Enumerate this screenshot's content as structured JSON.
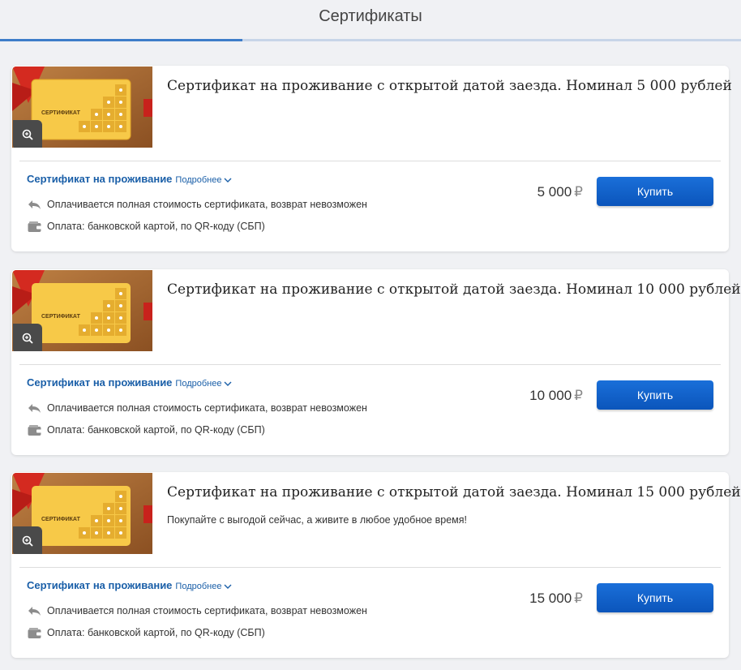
{
  "header": {
    "title": "Сертификаты"
  },
  "colors": {
    "accent": "#3d7dc9",
    "button": "#0b62cc",
    "link": "#1a5fa8",
    "card_gold": "#f5c542",
    "ribbon_red": "#c8221c"
  },
  "thumbnail": {
    "card_label": "СЕРТИФИКАТ"
  },
  "cards": [
    {
      "title": "Сертификат на проживание с открытой датой заезда. Номинал 5 000 рублей",
      "description": "",
      "category": "Сертификат на проживание",
      "more": "Подробнее",
      "refund": "Оплачивается полная стоимость сертификата, возврат невозможен",
      "payment": "Оплата: банковской картой, по QR-коду (СБП)",
      "price": "5 000",
      "currency": "₽",
      "buy_label": "Купить"
    },
    {
      "title": "Сертификат на проживание с открытой датой заезда. Номинал 10 000 рублей",
      "description": "",
      "category": "Сертификат на проживание",
      "more": "Подробнее",
      "refund": "Оплачивается полная стоимость сертификата, возврат невозможен",
      "payment": "Оплата: банковской картой, по QR-коду (СБП)",
      "price": "10 000",
      "currency": "₽",
      "buy_label": "Купить"
    },
    {
      "title": "Сертификат на проживание с открытой датой заезда. Номинал 15 000 рублей",
      "description": "Покупайте с выгодой сейчас, а живите в любое удобное время!",
      "category": "Сертификат на проживание",
      "more": "Подробнее",
      "refund": "Оплачивается полная стоимость сертификата, возврат невозможен",
      "payment": "Оплата: банковской картой, по QR-коду (СБП)",
      "price": "15 000",
      "currency": "₽",
      "buy_label": "Купить"
    }
  ]
}
